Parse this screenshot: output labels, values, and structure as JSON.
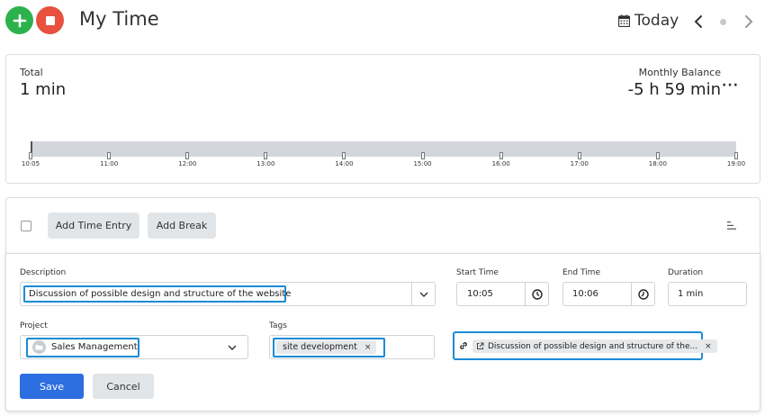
{
  "header": {
    "title": "My Time",
    "today_label": "Today",
    "add_icon": "plus-icon",
    "stop_icon": "stop-icon",
    "calendar_icon": "calendar-icon"
  },
  "summary": {
    "total_label": "Total",
    "total_value": "1 min",
    "balance_label": "Monthly Balance",
    "balance_value": "-5 h 59 min",
    "more_label": "···",
    "timeline_ticks": [
      "10:05",
      "11:00",
      "12:00",
      "13:00",
      "14:00",
      "15:00",
      "16:00",
      "17:00",
      "18:00",
      "19:00"
    ]
  },
  "toolbar": {
    "add_time_entry_label": "Add Time Entry",
    "add_break_label": "Add Break"
  },
  "form": {
    "description_label": "Description",
    "description_value": "Discussion of possible design and structure of the website",
    "start_time_label": "Start Time",
    "start_time_value": "10:05",
    "end_time_label": "End Time",
    "end_time_value": "10:06",
    "duration_label": "Duration",
    "duration_value": "1 min",
    "project_label": "Project",
    "project_value": "Sales Management",
    "tags_label": "Tags",
    "tag_value": "site development",
    "link_value": "Discussion of possible design and structure of the...",
    "chip_remove": "×",
    "save_label": "Save",
    "cancel_label": "Cancel"
  },
  "colors": {
    "add_button": "#2bb24c",
    "stop_button": "#e8503f",
    "primary": "#2d6ee0",
    "highlight": "#1b8bd6"
  }
}
